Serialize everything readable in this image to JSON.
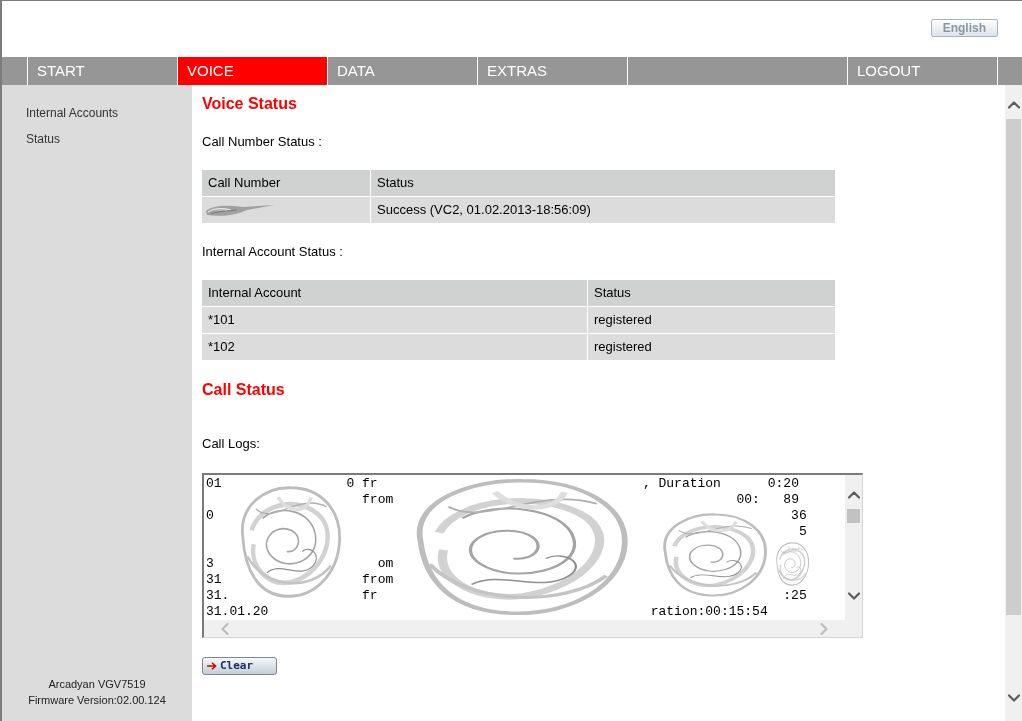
{
  "header": {
    "language_button": "English"
  },
  "nav": {
    "items": [
      {
        "label": "START",
        "selected": false
      },
      {
        "label": "VOICE",
        "selected": true
      },
      {
        "label": "DATA",
        "selected": false
      },
      {
        "label": "EXTRAS",
        "selected": false
      }
    ],
    "end_items": [
      {
        "label": "LOGOUT",
        "selected": false
      }
    ]
  },
  "sidebar": {
    "items": [
      {
        "label": "Internal Accounts",
        "selected": false
      },
      {
        "label": "Status",
        "selected": false
      }
    ],
    "device": "Arcadyan VGV7519",
    "firmware": "Firmware Version:02.00.124"
  },
  "voice_status": {
    "title": "Voice Status",
    "call_number_label": "Call Number Status :",
    "call_number_table": {
      "columns": [
        "Call Number",
        "Status"
      ],
      "rows": [
        {
          "status": "Success (VC2, 01.02.2013-18:56:09)"
        }
      ]
    },
    "internal_account_label": "Internal Account Status :",
    "internal_account_table": {
      "columns": [
        "Internal Account",
        "Status"
      ],
      "rows": [
        {
          "account": "*101",
          "status": "registered"
        },
        {
          "account": "*102",
          "status": "registered"
        }
      ]
    }
  },
  "call_status": {
    "title": "Call Status",
    "logs_label": "Call Logs:",
    "log_lines": [
      {
        "kind": "text",
        "text": "01                0 fr                                  , Duration      0:20"
      },
      {
        "kind": "text",
        "text": "                    from                                            00:   89"
      },
      {
        "kind": "text",
        "text": "0                                                                          36"
      },
      {
        "kind": "text",
        "text": "                                                                            5"
      },
      {
        "kind": "covered"
      },
      {
        "kind": "text",
        "text": "3                     om"
      },
      {
        "kind": "text",
        "text": "31                  from"
      },
      {
        "kind": "text",
        "text": "31.                 fr                                                    :25"
      },
      {
        "kind": "text",
        "text": "31.01.20                                                 ration:00:15:54"
      }
    ],
    "clear_button": "Clear"
  }
}
